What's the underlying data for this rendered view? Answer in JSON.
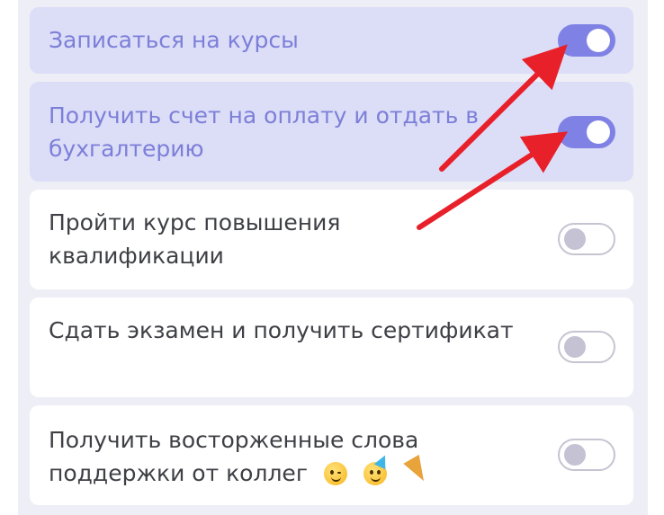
{
  "tasks": [
    {
      "label": "Записаться на курсы",
      "checked": true
    },
    {
      "label": "Получить счет на оплату и отдать в бухгалтерию",
      "checked": true
    },
    {
      "label": "Пройти курс повышения квалификации",
      "checked": false
    },
    {
      "label": "Сдать экзамен и получить сертификат",
      "checked": false
    },
    {
      "label": "Получить восторженные слова поддержки от коллег",
      "checked": false,
      "emojis": [
        "winking-face-icon",
        "partying-face-icon",
        "party-popper-icon"
      ]
    }
  ],
  "colors": {
    "checked_bg": "#dcddf7",
    "checked_text": "#7c7fd8",
    "toggle_on": "#7f82e4",
    "annotation_arrow": "#e8202a"
  }
}
